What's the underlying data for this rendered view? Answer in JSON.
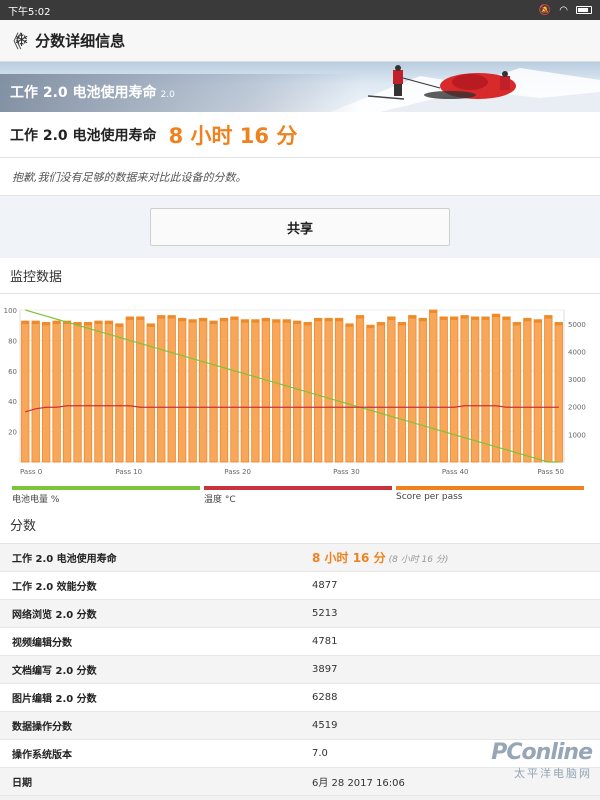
{
  "status_bar": {
    "time": "下午5:02"
  },
  "app_bar": {
    "back_glyph": "《",
    "title": "分数详细信息",
    "icon": "snowflake-icon"
  },
  "banner": {
    "title": "工作 2.0 电池使用寿命",
    "version": "2.0"
  },
  "result": {
    "label": "工作 2.0 电池使用寿命",
    "value": "8 小时 16 分"
  },
  "note": "抱歉,我们没有足够的数据来对比此设备的分数。",
  "share": {
    "label": "共享"
  },
  "monitor": {
    "heading": "监控数据"
  },
  "chart_data": {
    "type": "bar",
    "x_tick_labels": [
      "Pass 0",
      "Pass 10",
      "Pass 20",
      "Pass 30",
      "Pass 40",
      "Pass 50"
    ],
    "x_range": [
      0,
      50
    ],
    "left_axis": {
      "ticks": [
        20,
        40,
        60,
        80,
        100
      ],
      "range": [
        0,
        100
      ]
    },
    "right_axis": {
      "ticks": [
        1000,
        2000,
        3000,
        4000,
        5000
      ],
      "range": [
        0,
        5500
      ]
    },
    "legend": [
      "电池电量 %",
      "温度 °C",
      "Score per pass"
    ],
    "colors": {
      "battery": "#7cc43a",
      "temperature": "#c8323a",
      "score": "#f0821e"
    },
    "series": [
      {
        "name": "Score per pass",
        "axis": "right",
        "values": [
          5100,
          5100,
          5050,
          5100,
          5100,
          5050,
          5050,
          5100,
          5100,
          5000,
          5250,
          5250,
          5000,
          5300,
          5300,
          5200,
          5150,
          5200,
          5100,
          5200,
          5250,
          5150,
          5150,
          5200,
          5150,
          5150,
          5100,
          5050,
          5200,
          5200,
          5200,
          5000,
          5300,
          4950,
          5050,
          5250,
          5050,
          5300,
          5200,
          5500,
          5250,
          5250,
          5300,
          5250,
          5250,
          5350,
          5250,
          5050,
          5200,
          5150,
          5300,
          5050
        ]
      },
      {
        "name": "电池电量 %",
        "axis": "left",
        "values": [
          100,
          98,
          96,
          94,
          92,
          90,
          88,
          86,
          84,
          82,
          80,
          78,
          76,
          74,
          72,
          70,
          68,
          66,
          64,
          62,
          60,
          58,
          56,
          54,
          52,
          50,
          48,
          46,
          44,
          42,
          40,
          38,
          36,
          34,
          32,
          30,
          28,
          26,
          24,
          22,
          20,
          18,
          16,
          14,
          12,
          10,
          8,
          6,
          4,
          2,
          0,
          -2
        ]
      },
      {
        "name": "温度 °C",
        "axis": "left",
        "values": [
          33,
          35,
          36,
          36,
          37,
          37,
          37,
          37,
          37,
          37,
          37,
          36,
          36,
          36,
          36,
          36,
          36,
          36,
          36,
          36,
          36,
          36,
          36,
          36,
          36,
          36,
          36,
          36,
          36,
          36,
          36,
          36,
          36,
          36,
          36,
          36,
          36,
          36,
          36,
          36,
          36,
          36,
          37,
          37,
          37,
          37,
          36,
          36,
          36,
          36,
          36,
          36
        ]
      }
    ]
  },
  "scores": {
    "heading": "分数",
    "rows": [
      {
        "key": "工作 2.0 电池使用寿命",
        "value": "8 小时 16 分",
        "sub": "(8 小时 16 分)"
      },
      {
        "key": "工作 2.0 效能分数",
        "value": "4877"
      },
      {
        "key": "网络浏览 2.0 分数",
        "value": "5213"
      },
      {
        "key": "视频编辑分数",
        "value": "4781"
      },
      {
        "key": "文档编写 2.0 分数",
        "value": "3897"
      },
      {
        "key": "图片编辑 2.0 分数",
        "value": "6288"
      },
      {
        "key": "数据操作分数",
        "value": "4519"
      },
      {
        "key": "操作系统版本",
        "value": "7.0"
      },
      {
        "key": "日期",
        "value": "6月 28 2017 16:06"
      }
    ]
  },
  "watermark": {
    "line1": "PConline",
    "line2": "太平洋电脑网"
  }
}
